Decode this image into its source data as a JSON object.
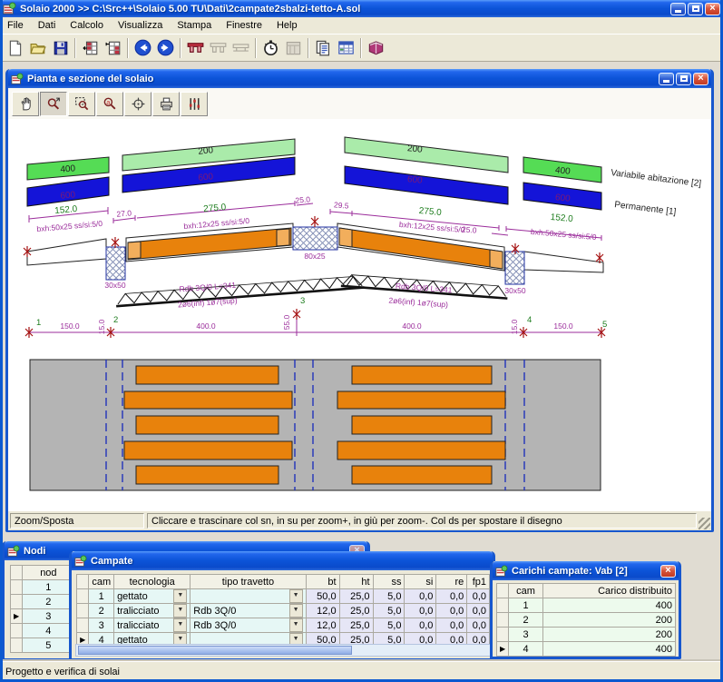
{
  "app": {
    "title": "Solaio 2000 >> C:\\Src++\\Solaio 5.00 TU\\Dati\\2campate2sbalzi-tetto-A.sol",
    "menu": [
      "File",
      "Dati",
      "Calcolo",
      "Visualizza",
      "Stampa",
      "Finestre",
      "Help"
    ],
    "toolbar_icons": [
      "new-document",
      "open-file",
      "save",
      "table-nodes",
      "table-spans",
      "navigate-back",
      "navigate-forward",
      "beam-section-active",
      "beam-section-disabled",
      "beam-slab-disabled",
      "calc-stopwatch",
      "calc-disabled",
      "copy-pages",
      "report-table",
      "help-book"
    ],
    "status": "Progetto e verifica di solai"
  },
  "drawing": {
    "title": "Pianta e sezione del solaio",
    "tools": [
      "pan-hand",
      "zoom-drag",
      "zoom-window",
      "zoom-letter",
      "center-view",
      "print",
      "options-sliders"
    ],
    "status_mode": "Zoom/Sposta",
    "status_hint": "Cliccare e trascinare col sn, in su per zoom+, in giù per zoom-. Col ds per spostare il disegno",
    "legend_variable": "Variabile abitazione [2]",
    "legend_permanent": "Permanente [1]",
    "loads": {
      "ovh_left": "400",
      "span_left": "200",
      "span_right": "200",
      "ovh_right": "400",
      "perm": "600"
    },
    "dims": {
      "ovh_left": "152.0",
      "ovh_left_spec": "bxh:50x25 ss/si:5/0",
      "d27": "27.0",
      "span_left": "275.0",
      "span_left_spec": "bxh:12x25 ss/si:5/0",
      "d25_left": "25.0",
      "d29": "29.5",
      "span_right": "275.0",
      "span_right_spec": "bxh:12x25 ss/si:5/0",
      "d25_right": "25.0",
      "ovh_right": "152.0",
      "ovh_right_spec": "bxh:50x25 ss/si:5/0",
      "col_left": "30x50",
      "col_right": "30x50",
      "ridge": "80x25",
      "truss_left": "Rdb 3Q/0 L=341",
      "truss_left_bars": "2ø6(inf)  1ø7(sup)",
      "truss_right": "Rdb 3Q/0 L=341",
      "truss_right_bars": "2ø6(inf)  1ø7(sup)",
      "n1": "1",
      "n2": "2",
      "n3": "3",
      "n4": "4",
      "n5": "5",
      "b1": "150.0",
      "b2": "400.0",
      "b3": "400.0",
      "b4": "150.0",
      "v2": "15.0",
      "v3": "55.0",
      "v4": "15.0"
    }
  },
  "nodi": {
    "title": "Nodi",
    "col_nod": "nod",
    "rows": [
      "1",
      "2",
      "3",
      "4",
      "5"
    ],
    "selected": "3"
  },
  "campate": {
    "title": "Campate",
    "headers": {
      "cam": "cam",
      "tecnologia": "tecnologia",
      "tipo": "tipo travetto",
      "bt": "bt",
      "ht": "ht",
      "ss": "ss",
      "si": "si",
      "re": "re",
      "fp1": "fp1"
    },
    "rows": [
      {
        "cam": "1",
        "tecnologia": "gettato",
        "tipo": "",
        "bt": "50,0",
        "ht": "25,0",
        "ss": "5,0",
        "si": "0,0",
        "re": "0,0",
        "fp1": "0,0"
      },
      {
        "cam": "2",
        "tecnologia": "tralicciato",
        "tipo": "Rdb 3Q/0",
        "bt": "12,0",
        "ht": "25,0",
        "ss": "5,0",
        "si": "0,0",
        "re": "0,0",
        "fp1": "0,0"
      },
      {
        "cam": "3",
        "tecnologia": "tralicciato",
        "tipo": "Rdb 3Q/0",
        "bt": "12,0",
        "ht": "25,0",
        "ss": "5,0",
        "si": "0,0",
        "re": "0,0",
        "fp1": "0,0"
      },
      {
        "cam": "4",
        "tecnologia": "gettato",
        "tipo": "",
        "bt": "50,0",
        "ht": "25,0",
        "ss": "5,0",
        "si": "0,0",
        "re": "0,0",
        "fp1": "0,0"
      }
    ],
    "selected": "4"
  },
  "carichi": {
    "title": "Carichi campate: Vab [2]",
    "headers": {
      "cam": "cam",
      "carico": "Carico distribuito"
    },
    "rows": [
      {
        "cam": "1",
        "carico": "400"
      },
      {
        "cam": "2",
        "carico": "200"
      },
      {
        "cam": "3",
        "carico": "200"
      },
      {
        "cam": "4",
        "carico": "400"
      }
    ],
    "selected": "4"
  }
}
